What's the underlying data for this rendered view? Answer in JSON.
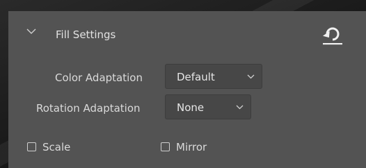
{
  "fill_settings": {
    "title": "Fill Settings",
    "collapse_icon": "chevron-down-icon",
    "reset_icon": "reset-icon",
    "color_adaptation": {
      "label": "Color Adaptation",
      "value": "Default"
    },
    "rotation_adaptation": {
      "label": "Rotation Adaptation",
      "value": "None"
    },
    "scale": {
      "label": "Scale",
      "checked": false
    },
    "mirror": {
      "label": "Mirror",
      "checked": false
    }
  },
  "colors": {
    "panel_background": "#535353",
    "control_background": "#474747",
    "text": "#dadada"
  }
}
